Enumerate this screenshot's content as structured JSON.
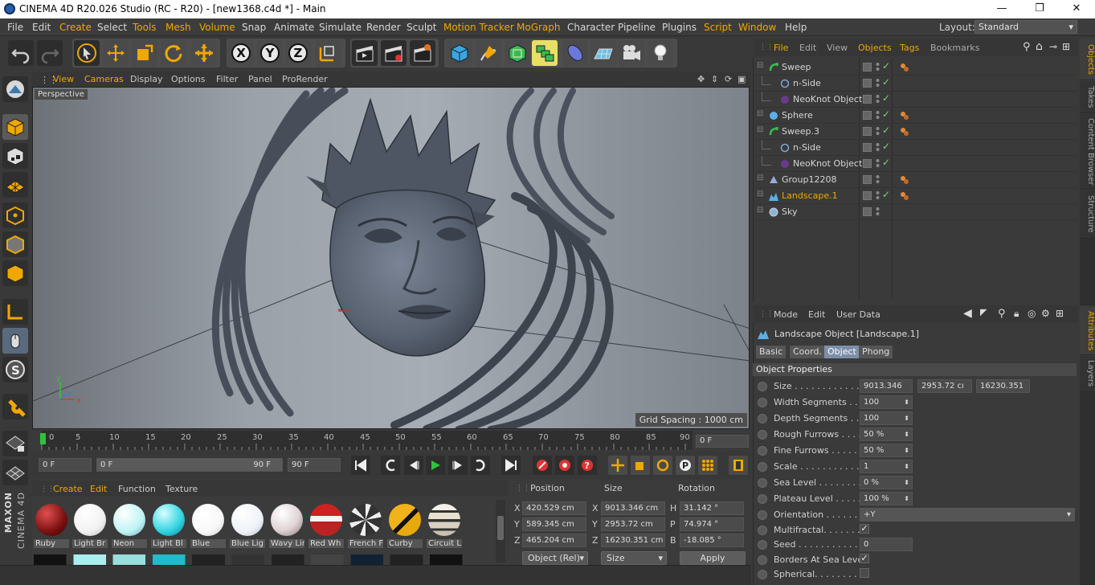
{
  "window": {
    "title": "CINEMA 4D R20.026 Studio (RC - R20) - [new1368.c4d *] - Main",
    "minimize": "—",
    "maximize": "❐",
    "close": "✕"
  },
  "menubar": {
    "items": [
      "File",
      "Edit",
      "Create",
      "Select",
      "Tools",
      "Mesh",
      "Volume",
      "Snap",
      "Animate",
      "Simulate",
      "Render",
      "Sculpt",
      "Motion Tracker",
      "MoGraph",
      "Character",
      "Pipeline",
      "Plugins",
      "Script",
      "Window",
      "Help"
    ],
    "layout_label": "Layout:",
    "layout_value": "Standard"
  },
  "toolbar": {
    "axis_x": "X",
    "axis_y": "Y",
    "axis_z": "Z"
  },
  "viewport": {
    "menu": [
      "View",
      "Cameras",
      "Display",
      "Options",
      "Filter",
      "Panel",
      "ProRender"
    ],
    "label": "Perspective",
    "grid_spacing": "Grid Spacing : 1000 cm",
    "axis_y": "y",
    "axis_z": "z",
    "axis_x": "x"
  },
  "timeline": {
    "ticks": [
      "0",
      "5",
      "10",
      "15",
      "20",
      "25",
      "30",
      "35",
      "40",
      "45",
      "50",
      "55",
      "60",
      "65",
      "70",
      "75",
      "80",
      "85",
      "90"
    ],
    "current_frame": "0 F"
  },
  "transport": {
    "start": "0 F",
    "range_start": "0 F",
    "range_end": "90 F",
    "end": "90 F"
  },
  "materials": {
    "menu": [
      "Create",
      "Edit",
      "Function",
      "Texture"
    ],
    "items": [
      {
        "name": "Ruby",
        "color": "#8a1515"
      },
      {
        "name": "Light Br",
        "color": "#f4f4f4"
      },
      {
        "name": "Neon",
        "color": "#bff3f3"
      },
      {
        "name": "Light Bl",
        "color": "#2fd3e0"
      },
      {
        "name": "Blue",
        "color": "#ffffff"
      },
      {
        "name": "Blue Lig",
        "color": "#eef2f8"
      },
      {
        "name": "Wavy Lin",
        "color": "#e0d4d6"
      },
      {
        "name": "Red Wh",
        "color": "#b22222"
      },
      {
        "name": "French F",
        "color": "#3d3d3d"
      },
      {
        "name": "Curby",
        "color": "#e7a90c"
      },
      {
        "name": "Circuit L",
        "color": "#d8d0c0"
      }
    ]
  },
  "coords": {
    "headers": [
      "Position",
      "Size",
      "Rotation"
    ],
    "rows": [
      {
        "axis": "X",
        "pos": "420.529 cm",
        "size_axis": "X",
        "size": "9013.346 cm",
        "rot_axis": "H",
        "rot": "31.142 °"
      },
      {
        "axis": "Y",
        "pos": "589.345 cm",
        "size_axis": "Y",
        "size": "2953.72 cm",
        "rot_axis": "P",
        "rot": "74.974 °"
      },
      {
        "axis": "Z",
        "pos": "465.204 cm",
        "size_axis": "Z",
        "size": "16230.351 cm",
        "rot_axis": "B",
        "rot": "-18.085 °"
      }
    ],
    "mode_select": "Object (Rel)",
    "size_select": "Size",
    "apply": "Apply"
  },
  "objects": {
    "menu": [
      "File",
      "Edit",
      "View",
      "Objects",
      "Tags",
      "Bookmarks"
    ],
    "rows": [
      {
        "name": "Sweep",
        "icon": "sweep-icon",
        "indent": 0,
        "check": "✓",
        "tag": true,
        "selected": false
      },
      {
        "name": "n-Side",
        "icon": "nside-icon",
        "indent": 1,
        "check": "✓",
        "tag": false,
        "selected": false
      },
      {
        "name": "NeoKnot Object",
        "icon": "neoknot-icon",
        "indent": 1,
        "check": "✓",
        "tag": false,
        "selected": false
      },
      {
        "name": "Sphere",
        "icon": "sphere-icon",
        "indent": 0,
        "check": "✓",
        "tag": true,
        "selected": false
      },
      {
        "name": "Sweep.3",
        "icon": "sweep-icon",
        "indent": 0,
        "check": "✓",
        "tag": true,
        "selected": false
      },
      {
        "name": "n-Side",
        "icon": "nside-icon",
        "indent": 1,
        "check": "✓",
        "tag": false,
        "selected": false
      },
      {
        "name": "NeoKnot Object",
        "icon": "neoknot-icon",
        "indent": 1,
        "check": "✓",
        "tag": false,
        "selected": false
      },
      {
        "name": "Group12208",
        "icon": "group-icon",
        "indent": 0,
        "check": "",
        "tag": true,
        "selected": false
      },
      {
        "name": "Landscape.1",
        "icon": "landscape-icon",
        "indent": 0,
        "check": "✓",
        "tag": true,
        "selected": true
      },
      {
        "name": "Sky",
        "icon": "sky-icon",
        "indent": 0,
        "check": "",
        "tag": false,
        "selected": false
      }
    ]
  },
  "sidetabs": {
    "top": [
      "Objects",
      "Takes",
      "Content Browser",
      "Structure"
    ],
    "bottom": [
      "Attributes",
      "Layers"
    ]
  },
  "attributes": {
    "menu": [
      "Mode",
      "Edit",
      "User Data"
    ],
    "object_title": "Landscape Object [Landscape.1]",
    "tabs": [
      "Basic",
      "Coord.",
      "Object",
      "Phong"
    ],
    "section": "Object Properties",
    "size": [
      "9013.346",
      "2953.72 cı",
      "16230.351"
    ],
    "properties": [
      {
        "label": "Width Segments",
        "dots": " . . . .",
        "value": "100"
      },
      {
        "label": "Depth Segments",
        "dots": " . . . .",
        "value": "100"
      },
      {
        "label": "Rough Furrows",
        "dots": " . . . .",
        "value": "50 %"
      },
      {
        "label": "Fine Furrows",
        "dots": " . . . . . .",
        "value": "50 %"
      },
      {
        "label": "Scale",
        "dots": " . . . . . . . . . . . . .",
        "value": "1"
      },
      {
        "label": "Sea Level",
        "dots": " . . . . . . . . .",
        "value": "0 %"
      },
      {
        "label": "Plateau Level",
        "dots": " . . . . .",
        "value": "100 %"
      }
    ],
    "orientation_label": "Orientation",
    "orientation_dots": " . . . . . . .",
    "orientation_value": "+Y",
    "size_label": "Size",
    "size_dots": " . . . . . . . . . . . . . . .",
    "multifractal_label": "Multifractal",
    "multifractal_dots": ". . . . . . .",
    "seed_label": "Seed",
    "seed_dots": " . . . . . . . . . . . . . .",
    "seed_value": "0",
    "borders_label": "Borders At Sea Level",
    "spherical_label": "Spherical",
    "spherical_dots": ". . . . . . . . . ."
  },
  "brand": {
    "maxon": "MAXON",
    "c4d": "CINEMA 4D"
  }
}
